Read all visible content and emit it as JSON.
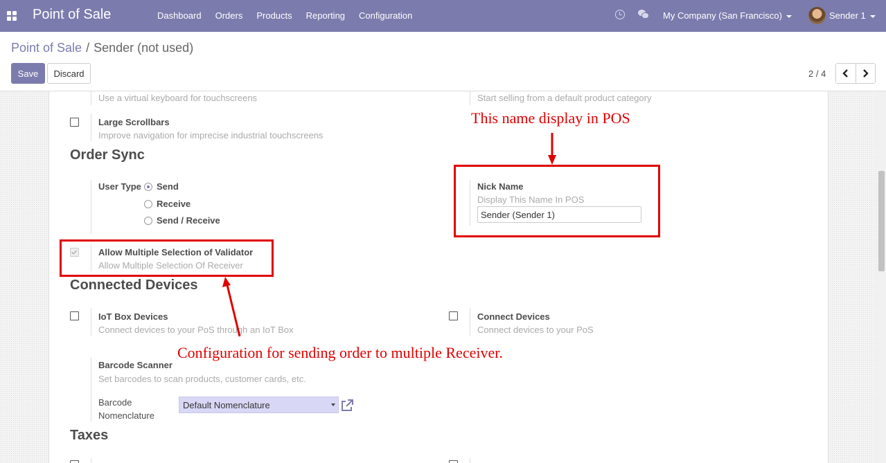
{
  "navbar": {
    "app_name": "Point of Sale",
    "menu": [
      "Dashboard",
      "Orders",
      "Products",
      "Reporting",
      "Configuration"
    ],
    "company": "My Company (San Francisco)",
    "user": "Sender 1"
  },
  "breadcrumb": {
    "parent": "Point of Sale",
    "separator": "/",
    "current": "Sender (not used)"
  },
  "buttons": {
    "save": "Save",
    "discard": "Discard"
  },
  "pager": {
    "value": "2 / 4"
  },
  "form": {
    "virtual_keyboard_help": "Use a virtual keyboard for touchscreens",
    "default_category_help": "Start selling from a default product category",
    "large_scrollbars": {
      "label": "Large Scrollbars",
      "help": "Improve navigation for imprecise industrial touchscreens",
      "checked": false
    },
    "order_sync": {
      "title": "Order Sync",
      "user_type_label": "User Type",
      "options": [
        "Send",
        "Receive",
        "Send / Receive"
      ],
      "selected": "Send",
      "nick_name_label": "Nick Name",
      "nick_name_help": "Display This Name In POS",
      "nick_name_value": "Sender (Sender 1)",
      "multi_validator_label": "Allow Multiple Selection of Validator",
      "multi_validator_help": "Allow Multiple Selection Of Receiver",
      "multi_validator_checked": true
    },
    "connected_devices": {
      "title": "Connected Devices",
      "iot_label": "IoT Box Devices",
      "iot_help": "Connect devices to your PoS through an IoT Box",
      "connect_label": "Connect Devices",
      "connect_help": "Connect devices to your PoS",
      "barcode_label": "Barcode Scanner",
      "barcode_help": "Set barcodes to scan products, customer cards, etc.",
      "nomenclature_label_line1": "Barcode",
      "nomenclature_label_line2": "Nomenclature",
      "nomenclature_value": "Default Nomenclature"
    },
    "taxes": {
      "title": "Taxes"
    }
  },
  "annotations": {
    "top": "This name display in POS",
    "bottom": "Configuration for sending order to multiple Receiver.",
    "color": "#e00000"
  },
  "colors": {
    "brand": "#7c7bad"
  }
}
